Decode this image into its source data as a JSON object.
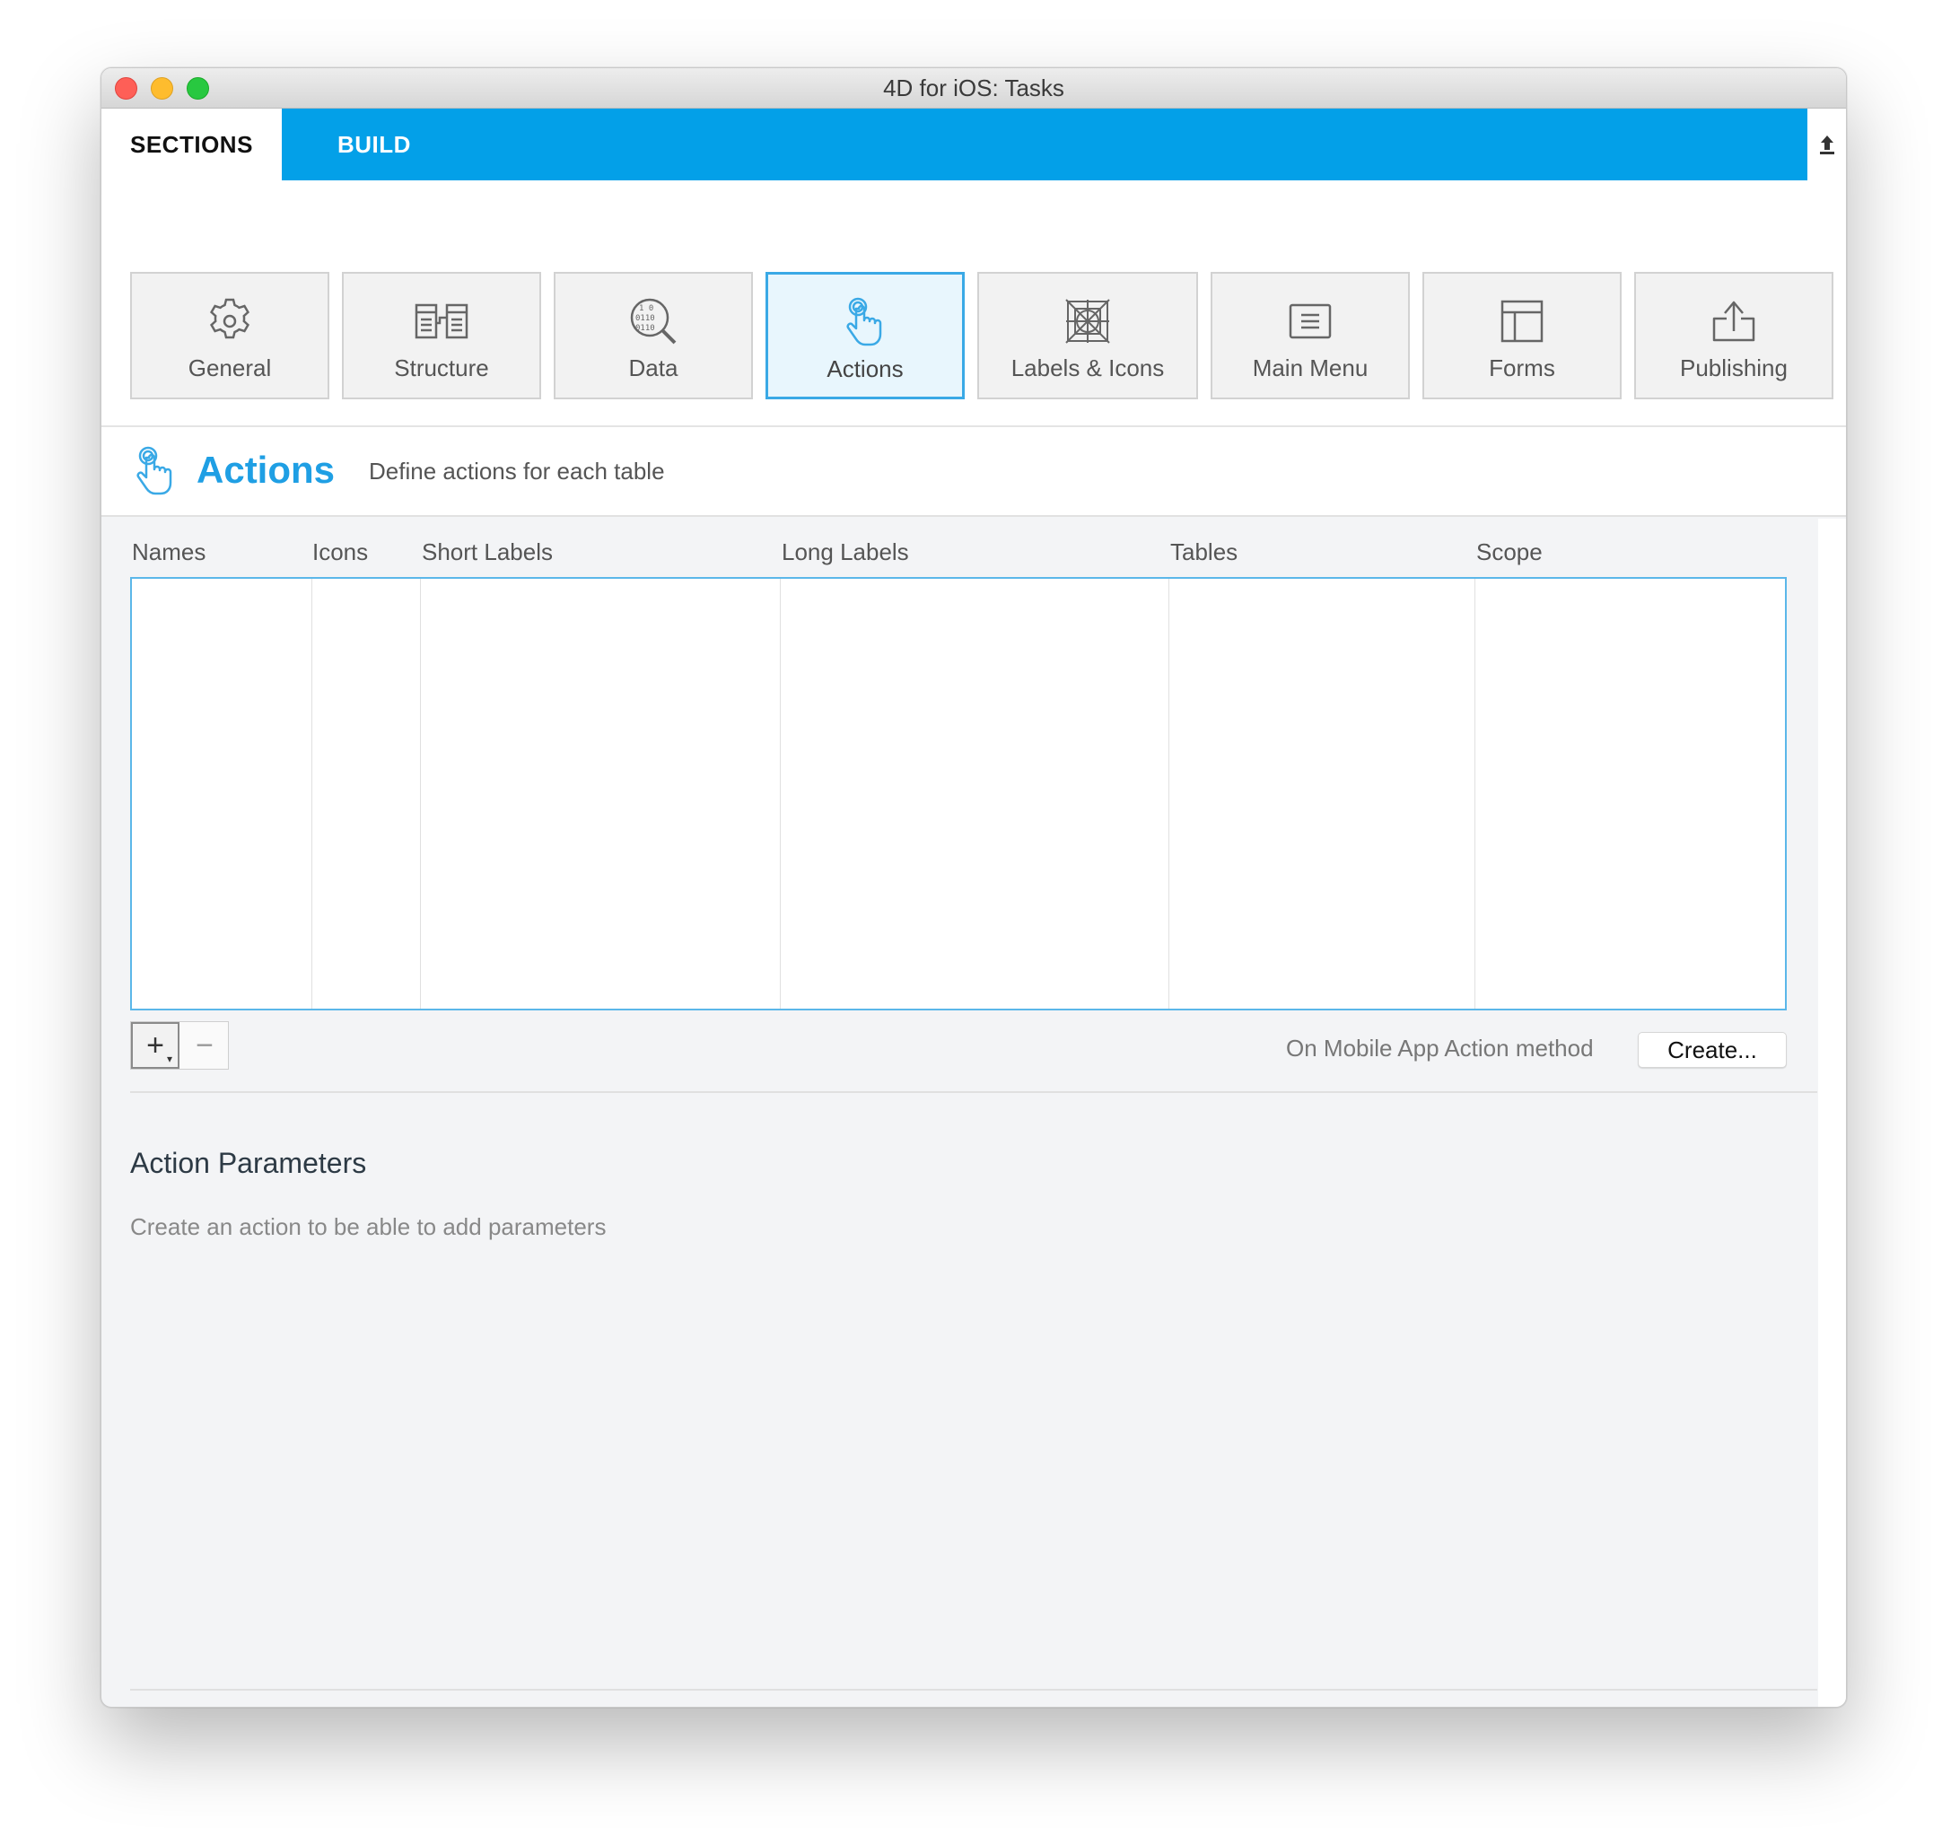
{
  "window": {
    "title": "4D for iOS: Tasks"
  },
  "tabs": {
    "sections": "SECTIONS",
    "build": "BUILD"
  },
  "sections": [
    {
      "label": "General",
      "icon": "gear-icon"
    },
    {
      "label": "Structure",
      "icon": "structure-icon"
    },
    {
      "label": "Data",
      "icon": "data-search-icon"
    },
    {
      "label": "Actions",
      "icon": "hand-pointer-icon",
      "active": true
    },
    {
      "label": "Labels & Icons",
      "icon": "labels-icons-icon"
    },
    {
      "label": "Main Menu",
      "icon": "main-menu-icon"
    },
    {
      "label": "Forms",
      "icon": "forms-icon"
    },
    {
      "label": "Publishing",
      "icon": "publish-icon"
    }
  ],
  "header": {
    "title": "Actions",
    "subtitle": "Define actions for each table"
  },
  "table": {
    "columns": [
      "Names",
      "Icons",
      "Short Labels",
      "Long Labels",
      "Tables",
      "Scope"
    ],
    "rows": []
  },
  "method": {
    "label": "On Mobile App Action method",
    "create_button": "Create..."
  },
  "params": {
    "title": "Action Parameters",
    "hint": "Create an action to be able to add parameters"
  },
  "colors": {
    "accent": "#03a0e8",
    "active_border": "#3aa9e6",
    "title_blue": "#1f9fe4"
  }
}
